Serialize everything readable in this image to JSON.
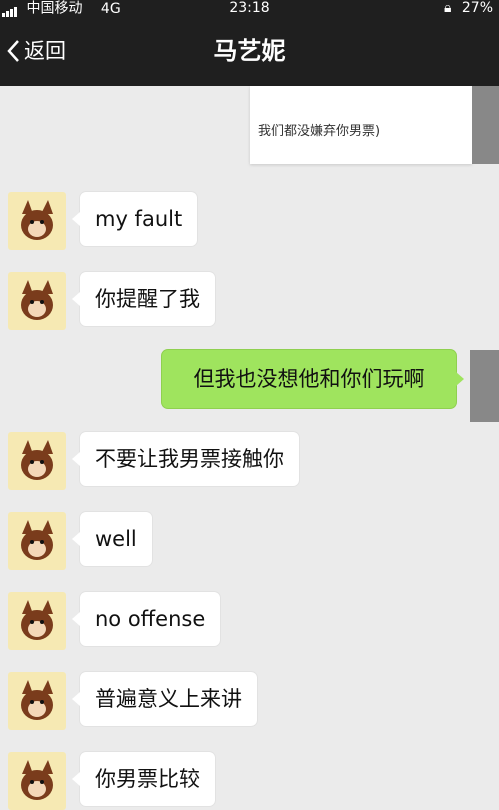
{
  "status_bar": {
    "carrier": "中国移动",
    "network": "4G",
    "time": "23:18",
    "battery": "27%"
  },
  "header": {
    "back_label": "返回",
    "title": "马艺妮"
  },
  "quoted_message": "我们都没嫌弃你男票)",
  "messages": [
    {
      "side": "incoming",
      "text": "my fault"
    },
    {
      "side": "incoming",
      "text": "你提醒了我"
    },
    {
      "side": "outgoing",
      "text": "但我也没想他和你们玩啊"
    },
    {
      "side": "incoming",
      "text": "不要让我男票接触你"
    },
    {
      "side": "incoming",
      "text": "well"
    },
    {
      "side": "incoming",
      "text": "no offense"
    },
    {
      "side": "incoming",
      "text": "普遍意义上来讲"
    },
    {
      "side": "incoming",
      "text": "你男票比较"
    }
  ],
  "colors": {
    "background": "#ebebeb",
    "navbar": "#1f1f1f",
    "outgoing_bubble": "#9fe45e",
    "incoming_bubble": "#ffffff",
    "avatar_bg": "#f6e9b3"
  },
  "icons": {
    "back": "chevron-left-icon",
    "battery": "battery-icon",
    "lock": "orientation-lock-icon",
    "signal": "signal-icon"
  }
}
